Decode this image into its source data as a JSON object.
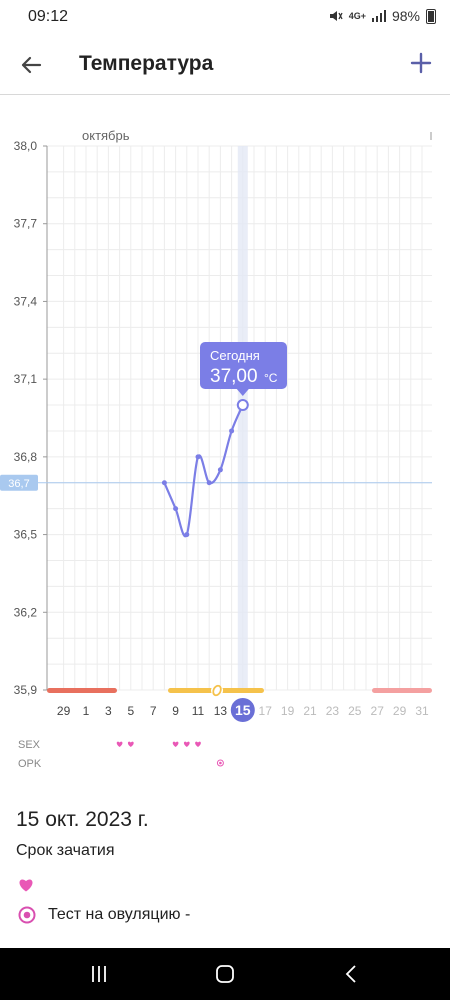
{
  "status_bar": {
    "time": "09:12",
    "network": "4G+",
    "battery": "98%"
  },
  "header": {
    "title": "Температура"
  },
  "chart_data": {
    "type": "line",
    "month_label": "октябрь",
    "y_ticks": [
      "38,0",
      "37,7",
      "37,4",
      "37,1",
      "36,8",
      "36,5",
      "36,2",
      "35,9"
    ],
    "ylim": [
      35.9,
      38.0
    ],
    "baseline_label": "36,7",
    "baseline_value": 36.7,
    "x_ticks": [
      "29",
      "1",
      "3",
      "5",
      "7",
      "9",
      "11",
      "13",
      "15",
      "17",
      "19",
      "21",
      "23",
      "25",
      "27",
      "29",
      "31"
    ],
    "today_label": "15",
    "series": [
      {
        "x": [
          "8 окт",
          "9 окт",
          "10 окт",
          "11 окт",
          "12 окт",
          "13 окт",
          "14 окт",
          "15 окт"
        ],
        "values": [
          36.7,
          36.6,
          36.5,
          36.8,
          36.7,
          36.75,
          36.9,
          37.0
        ]
      }
    ],
    "tooltip": {
      "label": "Сегодня",
      "value": "37,00",
      "unit": "°C"
    },
    "row_labels": {
      "sex": "SEX",
      "opk": "OPK"
    },
    "sex_days": [
      "4 окт",
      "5 окт",
      "9 окт",
      "10 окт",
      "11 окт"
    ],
    "opk_days": [
      "13 окт"
    ],
    "grid": true,
    "colors": {
      "line": "#7b7ee6",
      "tooltip": "#7b7ee6",
      "baseline": "#a9c9ef",
      "period": "#e8705e",
      "fertile": "#f5c24b",
      "next_period": "#f4a0a0",
      "heart": "#e958b6"
    }
  },
  "details": {
    "date": "15 окт. 2023 г.",
    "phase": "Срок зачатия",
    "test_label": "Тест на овуляцию -"
  }
}
